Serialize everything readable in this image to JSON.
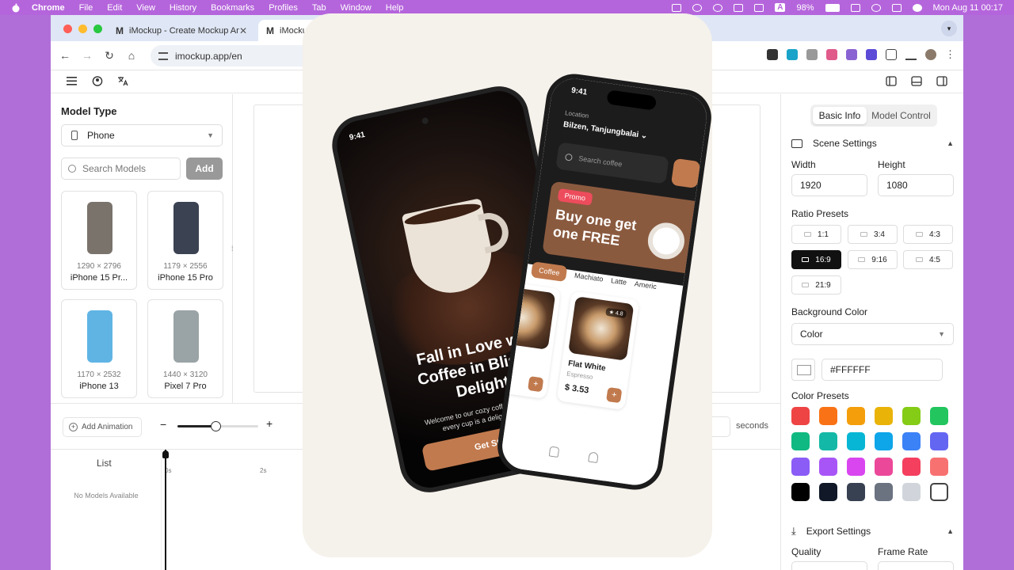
{
  "menubar": {
    "items": [
      "Chrome",
      "File",
      "Edit",
      "View",
      "History",
      "Bookmarks",
      "Profiles",
      "Tab",
      "Window",
      "Help"
    ],
    "battery": "98%",
    "a_box": "A",
    "datetime": "Mon Aug 11  00:17"
  },
  "browser": {
    "tabs": [
      {
        "logo": "M",
        "title": "iMockup - Create Mockup An",
        "close": "✕"
      },
      {
        "logo": "M",
        "title": "iMocku"
      }
    ],
    "url": "imockup.app/en"
  },
  "left_panel": {
    "model_type_title": "Model Type",
    "model_type_value": "Phone",
    "search_placeholder": "Search Models",
    "add_label": "Add",
    "models": [
      {
        "dims": "1290 × 2796",
        "name": "iPhone 15 Pr...",
        "color": "#7a736c"
      },
      {
        "dims": "1179 × 2556",
        "name": "iPhone 15 Pro",
        "color": "#3b4252"
      },
      {
        "dims": "1170 × 2532",
        "name": "iPhone 13",
        "color": "#5fb4e4"
      },
      {
        "dims": "1440 × 3120",
        "name": "Pixel 7 Pro",
        "color": "#9aa3a6"
      }
    ]
  },
  "right_panel": {
    "tabs": [
      "Basic Info",
      "Model Control"
    ],
    "scene_settings": "Scene Settings",
    "width_label": "Width",
    "height_label": "Height",
    "width_value": "1920",
    "height_value": "1080",
    "ratio_presets_label": "Ratio Presets",
    "ratios": [
      "1:1",
      "3:4",
      "4:3",
      "16:9",
      "9:16",
      "4:5",
      "21:9"
    ],
    "background_color_label": "Background Color",
    "background_mode": "Color",
    "hex_value": "#FFFFFF",
    "color_presets_label": "Color Presets",
    "color_presets": [
      "#ef4444",
      "#f97316",
      "#f59e0b",
      "#eab308",
      "#84cc16",
      "#22c55e",
      "#10b981",
      "#14b8a6",
      "#06b6d4",
      "#0ea5e9",
      "#3b82f6",
      "#6366f1",
      "#8b5cf6",
      "#a855f7",
      "#d946ef",
      "#ec4899",
      "#f43f5e",
      "#f87171",
      "#000000",
      "#111827",
      "#374151",
      "#6b7280",
      "#d1d5db",
      "#ffffff"
    ],
    "export_settings": "Export Settings",
    "quality_label": "Quality",
    "frame_rate_label": "Frame Rate"
  },
  "timeline": {
    "add_animation": "Add Animation",
    "zoom_level": 0.47,
    "seconds_label": "seconds",
    "list_title": "List",
    "empty_label": "No Models Available",
    "ticks": [
      "0s",
      "2s"
    ]
  },
  "promo": {
    "phone_a": {
      "time": "9:41",
      "headline": "Fall in Love with Coffee in Blissful Delight!",
      "subtext": "Welcome to our cozy coffee corner, where every cup is a delightful for you.",
      "cta": "Get Started"
    },
    "phone_b": {
      "time": "9:41",
      "location_label": "Location",
      "location_value": "Bilzen, Tanjungbalai ⌄",
      "search_placeholder": "Search coffee",
      "promo_tag": "Promo",
      "promo_title": "Buy one get one FREE",
      "categories": [
        "Coffee",
        "Machiato",
        "Latte",
        "Americ"
      ],
      "items": [
        {
          "name": "Flat White",
          "sub": "Espresso",
          "price": "$ 3.53",
          "rating": "★ 4.8"
        }
      ]
    }
  }
}
